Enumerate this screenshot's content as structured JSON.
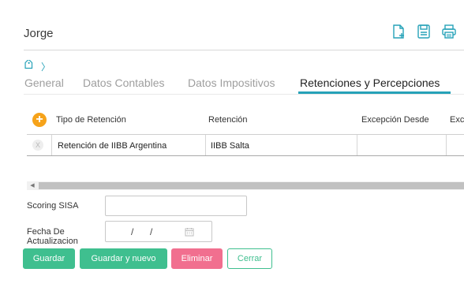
{
  "header": {
    "title": "Jorge",
    "icons": [
      "new-document-icon",
      "save-icon",
      "print-icon"
    ]
  },
  "breadcrumb": {
    "icon": "tag-icon",
    "separator": "〉"
  },
  "tabs": [
    {
      "label": "General",
      "active": false
    },
    {
      "label": "Datos Contables",
      "active": false
    },
    {
      "label": "Datos Impositivos",
      "active": false
    },
    {
      "label": "Retenciones y Percepciones",
      "active": true
    }
  ],
  "grid": {
    "add_symbol": "+",
    "delete_symbol": "X",
    "columns": [
      "Tipo de Retención",
      "Retención",
      "Excepción Desde",
      "Exc"
    ],
    "rows": [
      {
        "tipo": "Retención de IIBB Argentina",
        "retencion": "IIBB Salta",
        "excepcion_desde": "",
        "exc": ""
      }
    ]
  },
  "scrollbar": {
    "left_arrow": "◀"
  },
  "form": {
    "scoring_label": "Scoring SISA",
    "scoring_value": "",
    "fecha_label": "Fecha De Actualizacion",
    "fecha_separator": "/"
  },
  "buttons": {
    "guardar": "Guardar",
    "guardar_nuevo": "Guardar y nuevo",
    "eliminar": "Eliminar",
    "cerrar": "Cerrar"
  },
  "colors": {
    "accent": "#26a2b8",
    "add": "#f6a31a",
    "save": "#3fbf8f",
    "delete": "#f16f8f"
  }
}
